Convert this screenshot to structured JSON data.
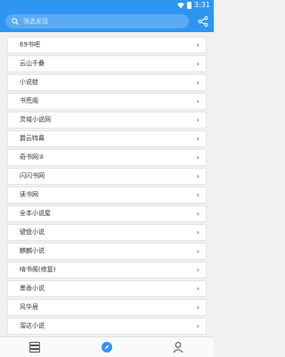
{
  "status_bar": {
    "time": "3:31"
  },
  "search": {
    "placeholder": "筛选发现"
  },
  "sources": [
    {
      "label": "69书吧"
    },
    {
      "label": "云山千叠"
    },
    {
      "label": "小说蛙"
    },
    {
      "label": "书荒阁"
    },
    {
      "label": "灵域小说网"
    },
    {
      "label": "爵云特幕"
    },
    {
      "label": "奇书网③"
    },
    {
      "label": "闪闪书网"
    },
    {
      "label": "读书网"
    },
    {
      "label": "全本小说屋"
    },
    {
      "label": "键盘小说"
    },
    {
      "label": "麒麟小说"
    },
    {
      "label": "啃书阁(修复)"
    },
    {
      "label": "墨香小说"
    },
    {
      "label": "风华居"
    },
    {
      "label": "溜达小说"
    },
    {
      "label": ""
    }
  ],
  "chevron": "›",
  "bottom_nav": [
    {
      "name": "bookshelf",
      "icon": "bookshelf-icon",
      "active": false
    },
    {
      "name": "discover",
      "icon": "compass-icon",
      "active": true
    },
    {
      "name": "mine",
      "icon": "person-icon",
      "active": false
    }
  ],
  "colors": {
    "accent": "#2e96f0",
    "active_nav": "#2e96f0",
    "inactive_nav": "#555555"
  }
}
